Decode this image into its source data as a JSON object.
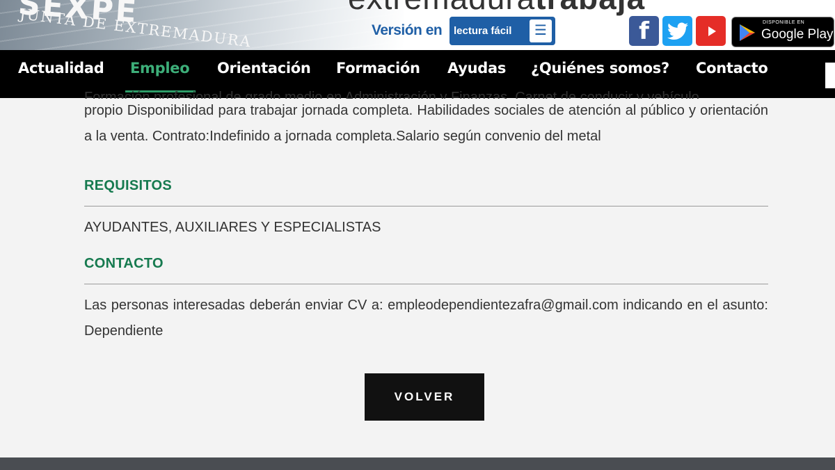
{
  "header": {
    "sexpe_logo_text": "SEXPE",
    "sexpe_subtitle": "JUNTA DE EXTREMADURA",
    "brand_title_light": "extremadura",
    "brand_title_bold": "trabaja",
    "lectura_facil_label": "Versión en",
    "lectura_facil_badge": "lectura fácil",
    "social": {
      "facebook_glyph": "f",
      "facebook_icon": "facebook-icon",
      "twitter_icon": "twitter-icon",
      "youtube_icon": "youtube-icon"
    },
    "google_play": {
      "small_text": "DISPONIBLE EN",
      "big_text": "Google Play"
    }
  },
  "nav": {
    "items": [
      {
        "label": "Actualidad"
      },
      {
        "label": "Empleo",
        "active": true
      },
      {
        "label": "Orientación"
      },
      {
        "label": "Formación"
      },
      {
        "label": "Ayudas"
      },
      {
        "label": "¿Quiénes somos?"
      },
      {
        "label": "Contacto"
      }
    ]
  },
  "offer": {
    "description_cut_line": "Formación profesional de grado medio en Administración y Finanzas. Carnet de conducir y vehículo",
    "description": "propio Disponibilidad para trabajar jornada completa. Habilidades sociales de atención al público y orientación a la venta. Contrato:Indefinido a jornada completa.Salario según convenio del metal",
    "requisitos_title": "REQUISITOS",
    "requisitos_text": "AYUDANTES, AUXILIARES Y ESPECIALISTAS",
    "contacto_title": "CONTACTO",
    "contacto_text": "Las personas interesadas deberán enviar CV a: empleodependientezafra@gmail.com indicando en el asunto: Dependiente",
    "volver_label": "VOLVER"
  },
  "colors": {
    "accent_green": "#167a4f",
    "nav_active": "#3dae79",
    "lectura_blue": "#1f5fa6"
  }
}
